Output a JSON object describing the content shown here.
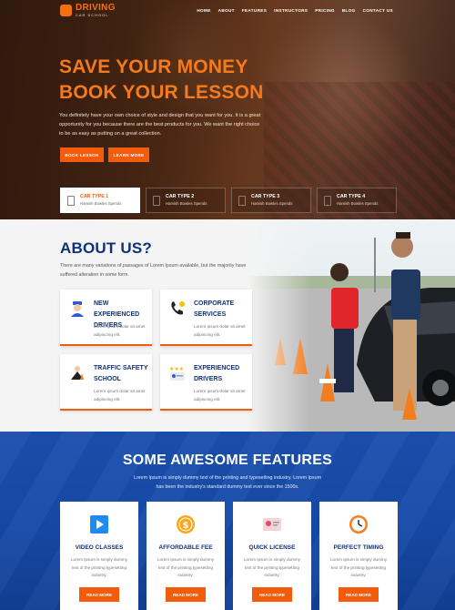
{
  "logo": {
    "main": "DRIVING",
    "sub": "CAR SCHOOL"
  },
  "nav": [
    "HOME",
    "ABOUT",
    "FEATURES",
    "INSTRUCTORS",
    "PRICING",
    "BLOG",
    "CONTACT US"
  ],
  "hero": {
    "title": "SAVE YOUR MONEY BOOK YOUR LESSON",
    "text": "You definitely have your own choice of style and design that you want for you. It is a great opportunity for you because there are the best products for you. We want the right choice to be as easy as putting on a great collection.",
    "book_label": "BOOK LESSON",
    "learn_label": "LEARN MORE"
  },
  "car_types": [
    {
      "title": "CAR TYPE 1",
      "sub": "Hamish Bowles Spends",
      "active": true
    },
    {
      "title": "CAR TYPE 2",
      "sub": "Hamish Bowles Spends",
      "active": false
    },
    {
      "title": "CAR TYPE 3",
      "sub": "Hamish Bowles Spends",
      "active": false
    },
    {
      "title": "CAR TYPE 4",
      "sub": "Hamish Bowles Spends",
      "active": false
    }
  ],
  "about": {
    "title": "ABOUT US?",
    "text": "There are many variations of passages of Lorem Ipsum available, but the majority have suffered alteration in some form.",
    "cards": [
      {
        "title": "NEW EXPERIENCED DRIVERS",
        "text": "Lorem ipsum dolar sit amet adipiscing elit.",
        "icon": "driver-icon"
      },
      {
        "title": "CORPORATE SERVICES",
        "text": "Lorem ipsum dolar sit amet adipiscing elit.",
        "icon": "phone-icon"
      },
      {
        "title": "TRAFFIC SAFETY SCHOOL",
        "text": "Lorem ipsum dolar sit amet adipiscing elit.",
        "icon": "traffic-cone-icon"
      },
      {
        "title": "EXPERIENCED DRIVERS",
        "text": "Lorem ipsum dolar sit amet adipiscing elit.",
        "icon": "star-rating-icon"
      }
    ]
  },
  "features": {
    "title": "SOME AWESOME FEATURES",
    "text": "Lorem Ipsum is simply dummy text of the printing and typesetting industry. Lorem Ipsum has been the industry's standard dummy text ever since the 1500s.",
    "cards": [
      {
        "title": "VIDEO CLASSES",
        "text": "Lorem Ipsum is simply dummy text of the printing typesetting industry.",
        "button": "READ MORE",
        "icon": "video-play-icon"
      },
      {
        "title": "AFFORDABLE FEE",
        "text": "Lorem Ipsum is simply dummy text of the printing typesetting industry.",
        "button": "READ MORE",
        "icon": "dollar-coin-icon"
      },
      {
        "title": "QUICK LICENSE",
        "text": "Lorem Ipsum is simply dummy text of the printing typesetting industry.",
        "button": "READ MORE",
        "icon": "license-card-icon"
      },
      {
        "title": "PERFECT TIMING",
        "text": "Lorem Ipsum is simply dummy text of the printing typesetting industry.",
        "button": "READ MORE",
        "icon": "clock-icon"
      }
    ]
  },
  "colors": {
    "accent": "#f45c0d",
    "navy": "#10317a",
    "blue_bg": "#1b4fae"
  }
}
